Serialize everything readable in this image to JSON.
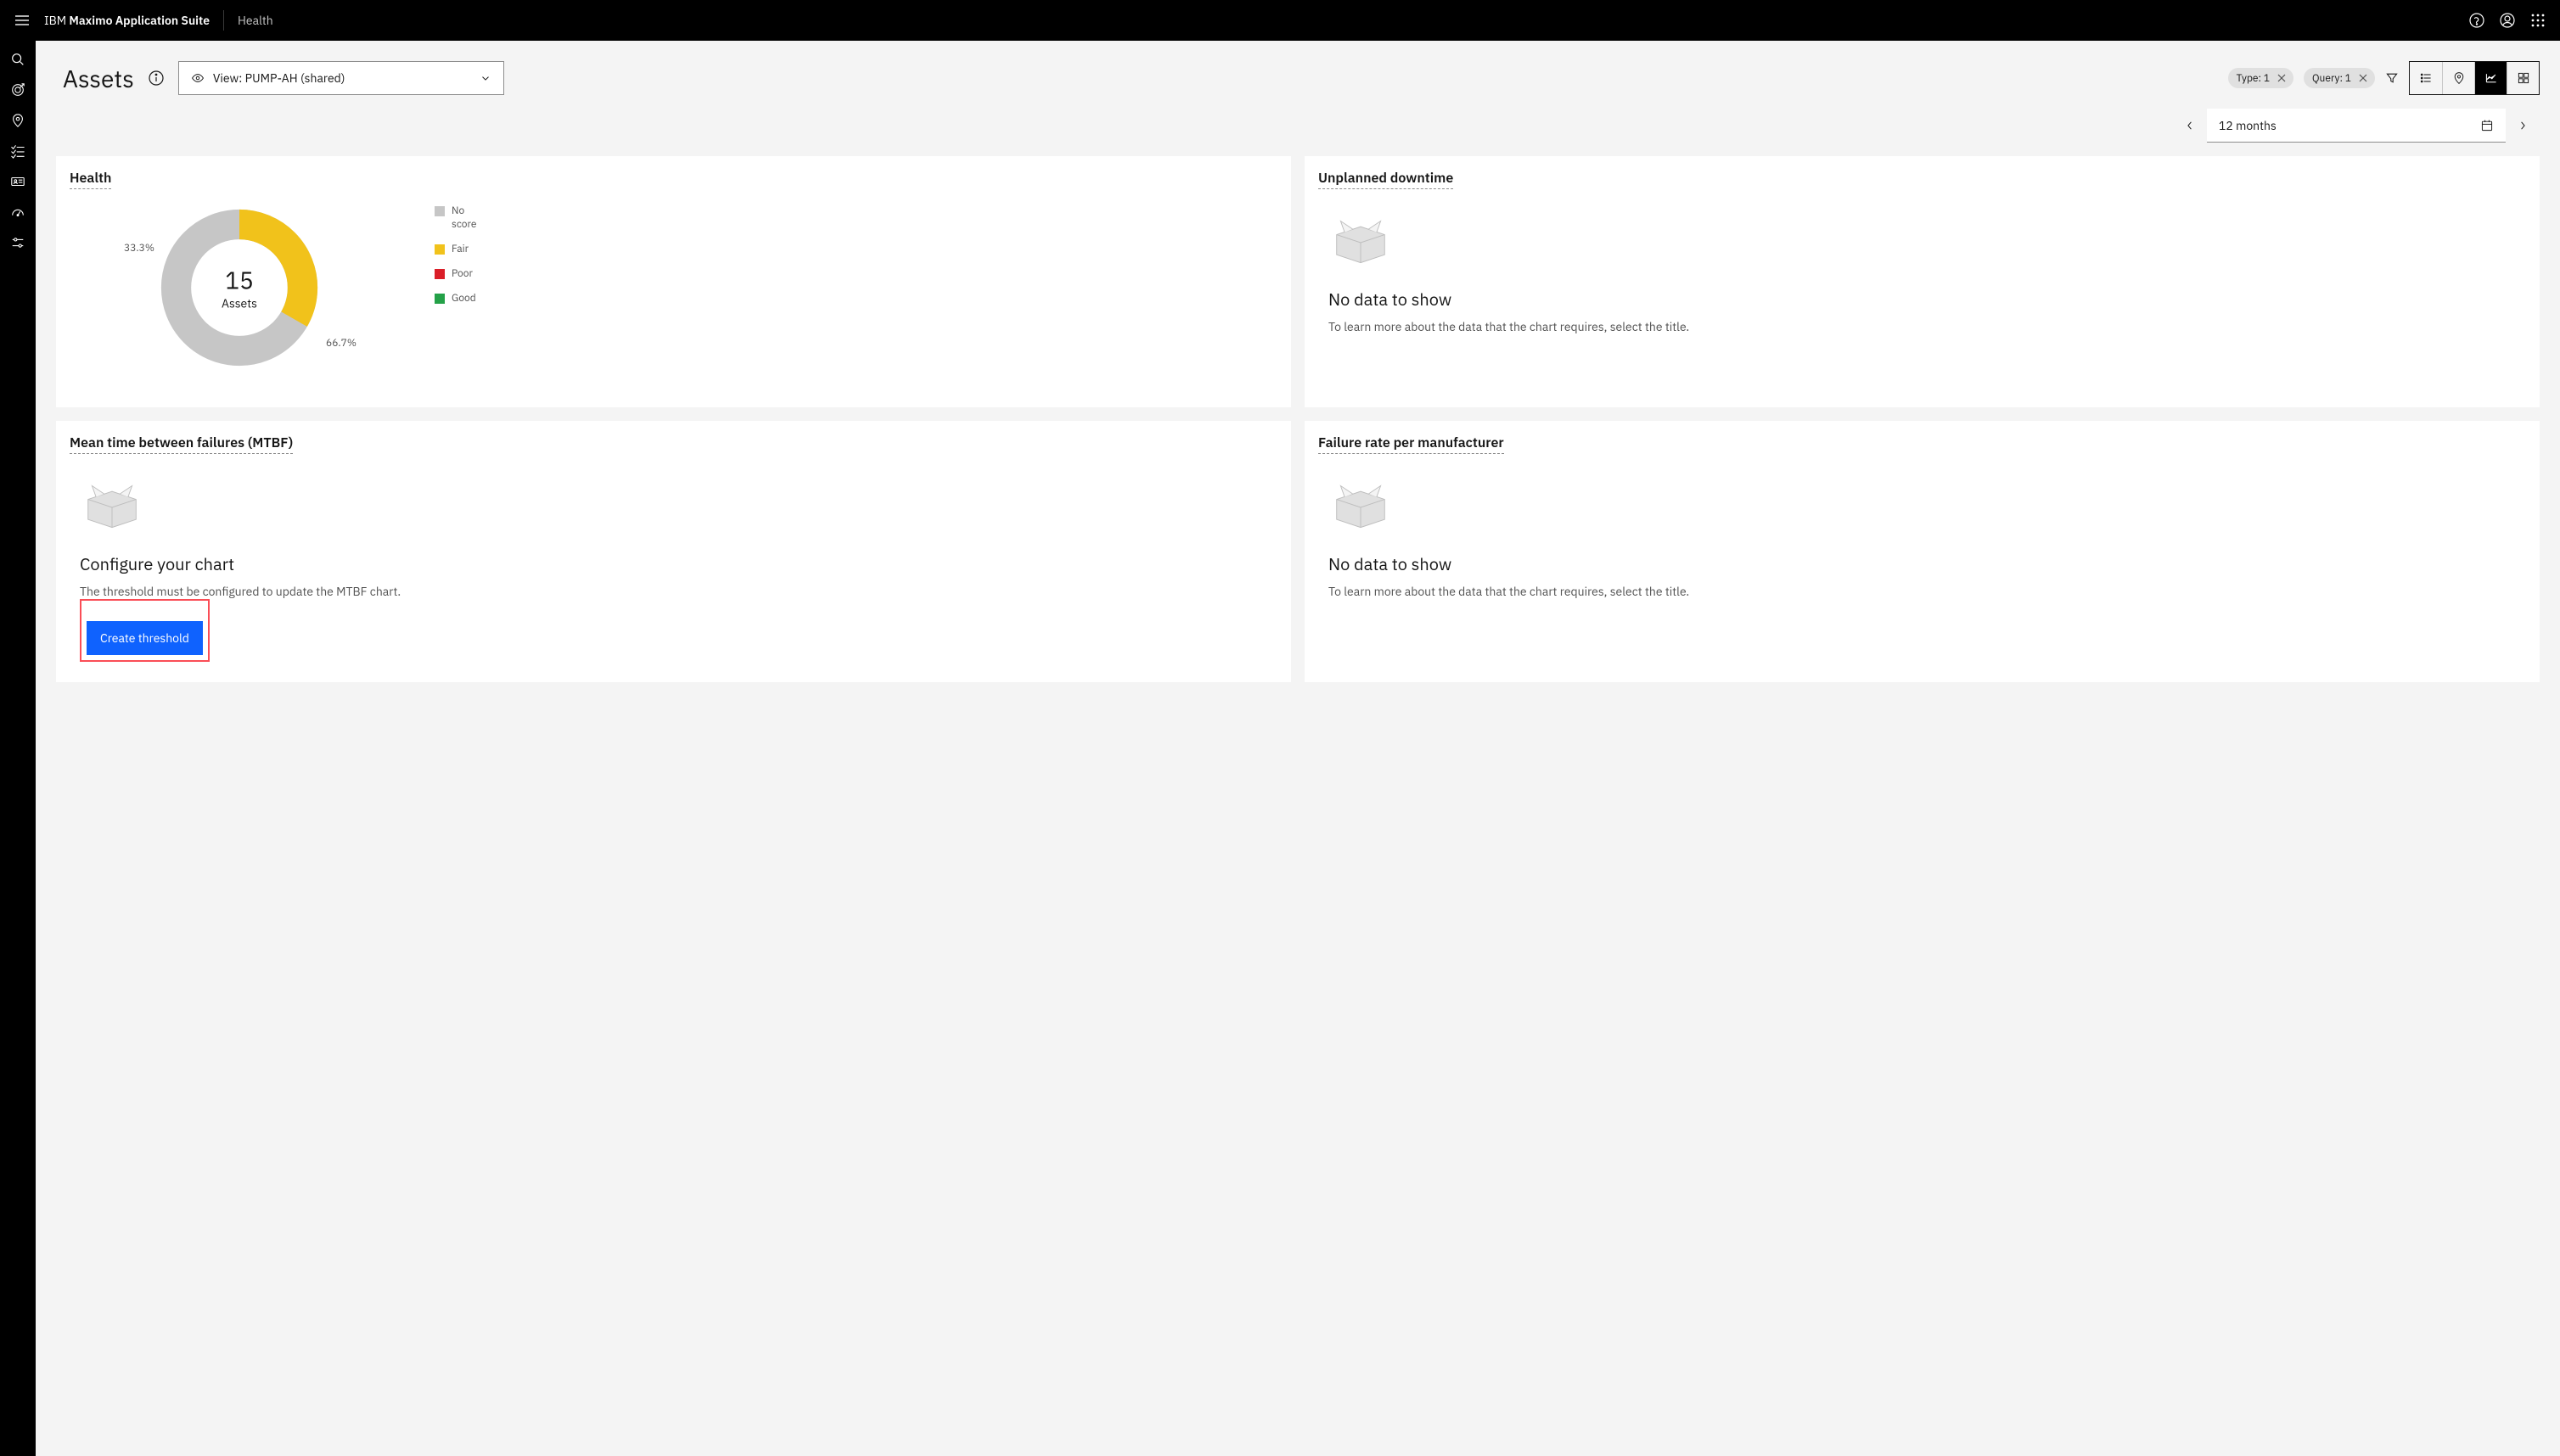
{
  "header": {
    "brand_prefix": "IBM ",
    "brand_bold": "Maximo Application Suite",
    "subtitle": "Health"
  },
  "page": {
    "title": "Assets",
    "view_label": "View: PUMP-AH (shared)"
  },
  "filters": {
    "type": "Type: 1",
    "query": "Query: 1"
  },
  "date": {
    "range": "12 months"
  },
  "cards": {
    "health": {
      "title": "Health",
      "center_value": "15",
      "center_label": "Assets",
      "pct_a": "33.3%",
      "pct_b": "66.7%",
      "legend": {
        "no_score": "No score",
        "fair": "Fair",
        "poor": "Poor",
        "good": "Good"
      }
    },
    "downtime": {
      "title": "Unplanned downtime",
      "empty_title": "No data to show",
      "empty_desc": "To learn more about the data that the chart requires, select the title."
    },
    "mtbf": {
      "title": "Mean time between failures (MTBF)",
      "empty_title": "Configure your chart",
      "empty_desc": "The threshold must be configured to update the MTBF chart.",
      "button": "Create threshold"
    },
    "failure_rate": {
      "title": "Failure rate per manufacturer",
      "empty_title": "No data to show",
      "empty_desc": "To learn more about the data that the chart requires, select the title."
    }
  },
  "chart_data": {
    "type": "pie",
    "title": "Health",
    "center": {
      "value": 15,
      "label": "Assets"
    },
    "series": [
      {
        "name": "Fair",
        "value": 33.3,
        "color": "#f1c21b"
      },
      {
        "name": "No score",
        "value": 66.7,
        "color": "#c6c6c6"
      }
    ],
    "legend_entries": [
      "No score",
      "Fair",
      "Poor",
      "Good"
    ]
  }
}
